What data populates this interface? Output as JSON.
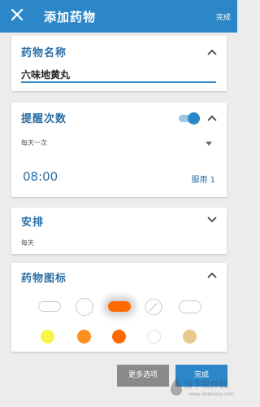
{
  "appbar": {
    "title": "添加药物",
    "done_label": "完成",
    "close_icon": "close-icon"
  },
  "name_card": {
    "title": "药物名称",
    "value": "六味地黄丸"
  },
  "remind_card": {
    "title": "提醒次数",
    "toggle_on": true,
    "frequency": "每天一次",
    "time": "08:00",
    "dose": "服用 1"
  },
  "schedule_card": {
    "title": "安排",
    "value": "每天"
  },
  "icons_card": {
    "title": "药物图标",
    "shapes": [
      "oval-pill",
      "round-pill",
      "capsule",
      "scored-tablet",
      "oval-tablet"
    ],
    "selected_shape": "capsule",
    "colors": [
      "#f5f54a",
      "#ff8f1f",
      "#ff6a00",
      "#ffffff",
      "#e6c98b"
    ],
    "selected_color": "#ff6a00"
  },
  "buttons": {
    "more_label": "更多选项",
    "done_label": "完成"
  },
  "watermark": {
    "text": "当下软件园",
    "url": "www.downxia.com"
  },
  "colors": {
    "primary": "#2c87c8",
    "accent": "#ff6a00"
  }
}
